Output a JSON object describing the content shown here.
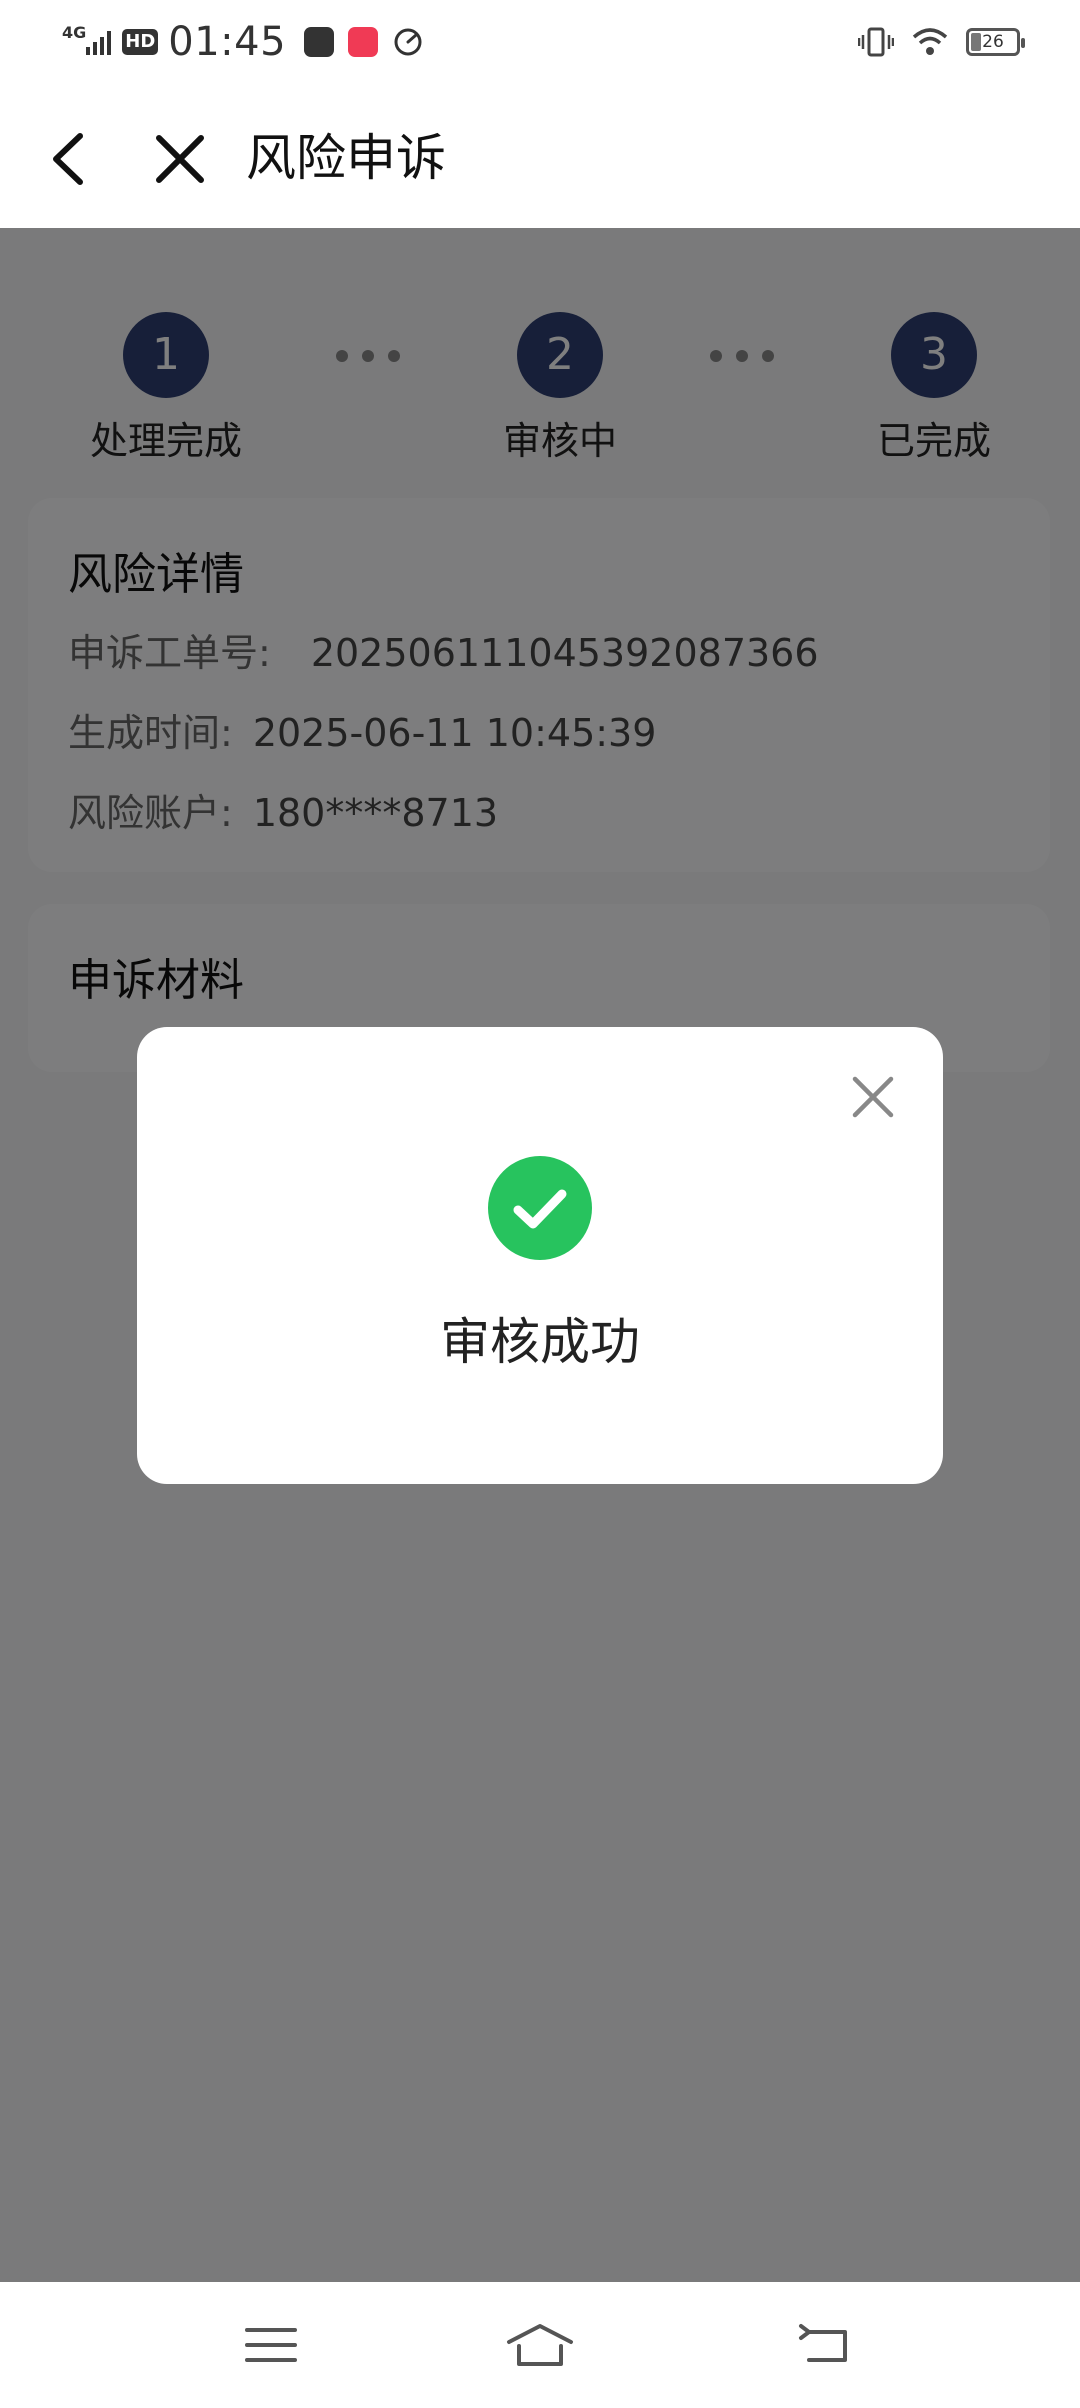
{
  "status_bar": {
    "network": "4G",
    "hd": "HD",
    "time": "01:45",
    "battery": "26",
    "icons": [
      "store-notification-icon",
      "red-app-notification-icon",
      "speed-app-notification-icon",
      "vibrate-icon",
      "wifi-icon",
      "battery-icon"
    ]
  },
  "header": {
    "title": "风险申诉"
  },
  "steps": [
    {
      "number": "1",
      "label": "处理完成"
    },
    {
      "number": "2",
      "label": "审核中"
    },
    {
      "number": "3",
      "label": "已完成"
    }
  ],
  "risk_details": {
    "title": "风险详情",
    "ticket_label": "申诉工单号:",
    "ticket_value": "20250611104539208736​6",
    "time_label": "生成时间:",
    "time_value": "2025-06-11 10:45:39",
    "account_label": "风险账户:",
    "account_value": "180****8713"
  },
  "materials": {
    "title": "申诉材料"
  },
  "modal": {
    "message": "审核成功"
  },
  "colors": {
    "step": "#2e3e72",
    "success": "#27c35e",
    "overlay": "rgba(0,0,0,0.5)"
  }
}
